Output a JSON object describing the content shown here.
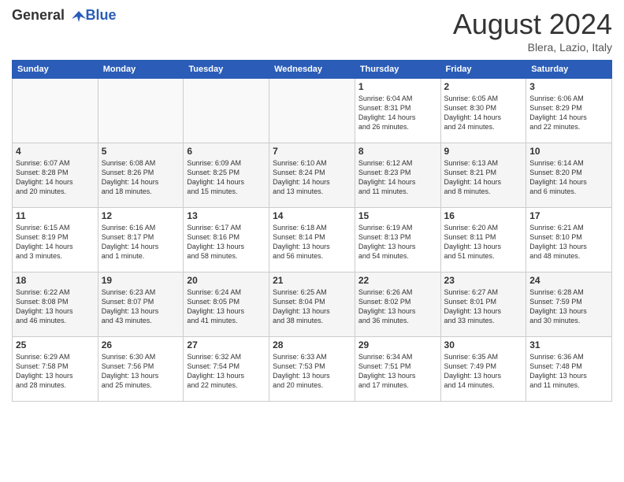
{
  "header": {
    "logo_general": "General",
    "logo_blue": "Blue",
    "month": "August 2024",
    "location": "Blera, Lazio, Italy"
  },
  "weekdays": [
    "Sunday",
    "Monday",
    "Tuesday",
    "Wednesday",
    "Thursday",
    "Friday",
    "Saturday"
  ],
  "weeks": [
    [
      {
        "day": "",
        "info": ""
      },
      {
        "day": "",
        "info": ""
      },
      {
        "day": "",
        "info": ""
      },
      {
        "day": "",
        "info": ""
      },
      {
        "day": "1",
        "info": "Sunrise: 6:04 AM\nSunset: 8:31 PM\nDaylight: 14 hours\nand 26 minutes."
      },
      {
        "day": "2",
        "info": "Sunrise: 6:05 AM\nSunset: 8:30 PM\nDaylight: 14 hours\nand 24 minutes."
      },
      {
        "day": "3",
        "info": "Sunrise: 6:06 AM\nSunset: 8:29 PM\nDaylight: 14 hours\nand 22 minutes."
      }
    ],
    [
      {
        "day": "4",
        "info": "Sunrise: 6:07 AM\nSunset: 8:28 PM\nDaylight: 14 hours\nand 20 minutes."
      },
      {
        "day": "5",
        "info": "Sunrise: 6:08 AM\nSunset: 8:26 PM\nDaylight: 14 hours\nand 18 minutes."
      },
      {
        "day": "6",
        "info": "Sunrise: 6:09 AM\nSunset: 8:25 PM\nDaylight: 14 hours\nand 15 minutes."
      },
      {
        "day": "7",
        "info": "Sunrise: 6:10 AM\nSunset: 8:24 PM\nDaylight: 14 hours\nand 13 minutes."
      },
      {
        "day": "8",
        "info": "Sunrise: 6:12 AM\nSunset: 8:23 PM\nDaylight: 14 hours\nand 11 minutes."
      },
      {
        "day": "9",
        "info": "Sunrise: 6:13 AM\nSunset: 8:21 PM\nDaylight: 14 hours\nand 8 minutes."
      },
      {
        "day": "10",
        "info": "Sunrise: 6:14 AM\nSunset: 8:20 PM\nDaylight: 14 hours\nand 6 minutes."
      }
    ],
    [
      {
        "day": "11",
        "info": "Sunrise: 6:15 AM\nSunset: 8:19 PM\nDaylight: 14 hours\nand 3 minutes."
      },
      {
        "day": "12",
        "info": "Sunrise: 6:16 AM\nSunset: 8:17 PM\nDaylight: 14 hours\nand 1 minute."
      },
      {
        "day": "13",
        "info": "Sunrise: 6:17 AM\nSunset: 8:16 PM\nDaylight: 13 hours\nand 58 minutes."
      },
      {
        "day": "14",
        "info": "Sunrise: 6:18 AM\nSunset: 8:14 PM\nDaylight: 13 hours\nand 56 minutes."
      },
      {
        "day": "15",
        "info": "Sunrise: 6:19 AM\nSunset: 8:13 PM\nDaylight: 13 hours\nand 54 minutes."
      },
      {
        "day": "16",
        "info": "Sunrise: 6:20 AM\nSunset: 8:11 PM\nDaylight: 13 hours\nand 51 minutes."
      },
      {
        "day": "17",
        "info": "Sunrise: 6:21 AM\nSunset: 8:10 PM\nDaylight: 13 hours\nand 48 minutes."
      }
    ],
    [
      {
        "day": "18",
        "info": "Sunrise: 6:22 AM\nSunset: 8:08 PM\nDaylight: 13 hours\nand 46 minutes."
      },
      {
        "day": "19",
        "info": "Sunrise: 6:23 AM\nSunset: 8:07 PM\nDaylight: 13 hours\nand 43 minutes."
      },
      {
        "day": "20",
        "info": "Sunrise: 6:24 AM\nSunset: 8:05 PM\nDaylight: 13 hours\nand 41 minutes."
      },
      {
        "day": "21",
        "info": "Sunrise: 6:25 AM\nSunset: 8:04 PM\nDaylight: 13 hours\nand 38 minutes."
      },
      {
        "day": "22",
        "info": "Sunrise: 6:26 AM\nSunset: 8:02 PM\nDaylight: 13 hours\nand 36 minutes."
      },
      {
        "day": "23",
        "info": "Sunrise: 6:27 AM\nSunset: 8:01 PM\nDaylight: 13 hours\nand 33 minutes."
      },
      {
        "day": "24",
        "info": "Sunrise: 6:28 AM\nSunset: 7:59 PM\nDaylight: 13 hours\nand 30 minutes."
      }
    ],
    [
      {
        "day": "25",
        "info": "Sunrise: 6:29 AM\nSunset: 7:58 PM\nDaylight: 13 hours\nand 28 minutes."
      },
      {
        "day": "26",
        "info": "Sunrise: 6:30 AM\nSunset: 7:56 PM\nDaylight: 13 hours\nand 25 minutes."
      },
      {
        "day": "27",
        "info": "Sunrise: 6:32 AM\nSunset: 7:54 PM\nDaylight: 13 hours\nand 22 minutes."
      },
      {
        "day": "28",
        "info": "Sunrise: 6:33 AM\nSunset: 7:53 PM\nDaylight: 13 hours\nand 20 minutes."
      },
      {
        "day": "29",
        "info": "Sunrise: 6:34 AM\nSunset: 7:51 PM\nDaylight: 13 hours\nand 17 minutes."
      },
      {
        "day": "30",
        "info": "Sunrise: 6:35 AM\nSunset: 7:49 PM\nDaylight: 13 hours\nand 14 minutes."
      },
      {
        "day": "31",
        "info": "Sunrise: 6:36 AM\nSunset: 7:48 PM\nDaylight: 13 hours\nand 11 minutes."
      }
    ]
  ]
}
